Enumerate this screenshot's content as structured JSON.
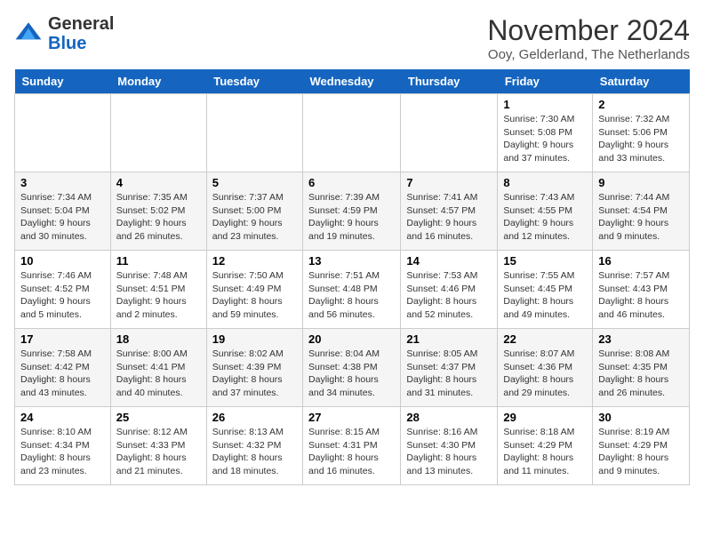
{
  "app": {
    "name": "GeneralBlue",
    "logo_text_general": "General",
    "logo_text_blue": "Blue"
  },
  "header": {
    "month_year": "November 2024",
    "location": "Ooy, Gelderland, The Netherlands"
  },
  "days_of_week": [
    "Sunday",
    "Monday",
    "Tuesday",
    "Wednesday",
    "Thursday",
    "Friday",
    "Saturday"
  ],
  "weeks": [
    [
      {
        "day": "",
        "info": ""
      },
      {
        "day": "",
        "info": ""
      },
      {
        "day": "",
        "info": ""
      },
      {
        "day": "",
        "info": ""
      },
      {
        "day": "",
        "info": ""
      },
      {
        "day": "1",
        "info": "Sunrise: 7:30 AM\nSunset: 5:08 PM\nDaylight: 9 hours and 37 minutes."
      },
      {
        "day": "2",
        "info": "Sunrise: 7:32 AM\nSunset: 5:06 PM\nDaylight: 9 hours and 33 minutes."
      }
    ],
    [
      {
        "day": "3",
        "info": "Sunrise: 7:34 AM\nSunset: 5:04 PM\nDaylight: 9 hours and 30 minutes."
      },
      {
        "day": "4",
        "info": "Sunrise: 7:35 AM\nSunset: 5:02 PM\nDaylight: 9 hours and 26 minutes."
      },
      {
        "day": "5",
        "info": "Sunrise: 7:37 AM\nSunset: 5:00 PM\nDaylight: 9 hours and 23 minutes."
      },
      {
        "day": "6",
        "info": "Sunrise: 7:39 AM\nSunset: 4:59 PM\nDaylight: 9 hours and 19 minutes."
      },
      {
        "day": "7",
        "info": "Sunrise: 7:41 AM\nSunset: 4:57 PM\nDaylight: 9 hours and 16 minutes."
      },
      {
        "day": "8",
        "info": "Sunrise: 7:43 AM\nSunset: 4:55 PM\nDaylight: 9 hours and 12 minutes."
      },
      {
        "day": "9",
        "info": "Sunrise: 7:44 AM\nSunset: 4:54 PM\nDaylight: 9 hours and 9 minutes."
      }
    ],
    [
      {
        "day": "10",
        "info": "Sunrise: 7:46 AM\nSunset: 4:52 PM\nDaylight: 9 hours and 5 minutes."
      },
      {
        "day": "11",
        "info": "Sunrise: 7:48 AM\nSunset: 4:51 PM\nDaylight: 9 hours and 2 minutes."
      },
      {
        "day": "12",
        "info": "Sunrise: 7:50 AM\nSunset: 4:49 PM\nDaylight: 8 hours and 59 minutes."
      },
      {
        "day": "13",
        "info": "Sunrise: 7:51 AM\nSunset: 4:48 PM\nDaylight: 8 hours and 56 minutes."
      },
      {
        "day": "14",
        "info": "Sunrise: 7:53 AM\nSunset: 4:46 PM\nDaylight: 8 hours and 52 minutes."
      },
      {
        "day": "15",
        "info": "Sunrise: 7:55 AM\nSunset: 4:45 PM\nDaylight: 8 hours and 49 minutes."
      },
      {
        "day": "16",
        "info": "Sunrise: 7:57 AM\nSunset: 4:43 PM\nDaylight: 8 hours and 46 minutes."
      }
    ],
    [
      {
        "day": "17",
        "info": "Sunrise: 7:58 AM\nSunset: 4:42 PM\nDaylight: 8 hours and 43 minutes."
      },
      {
        "day": "18",
        "info": "Sunrise: 8:00 AM\nSunset: 4:41 PM\nDaylight: 8 hours and 40 minutes."
      },
      {
        "day": "19",
        "info": "Sunrise: 8:02 AM\nSunset: 4:39 PM\nDaylight: 8 hours and 37 minutes."
      },
      {
        "day": "20",
        "info": "Sunrise: 8:04 AM\nSunset: 4:38 PM\nDaylight: 8 hours and 34 minutes."
      },
      {
        "day": "21",
        "info": "Sunrise: 8:05 AM\nSunset: 4:37 PM\nDaylight: 8 hours and 31 minutes."
      },
      {
        "day": "22",
        "info": "Sunrise: 8:07 AM\nSunset: 4:36 PM\nDaylight: 8 hours and 29 minutes."
      },
      {
        "day": "23",
        "info": "Sunrise: 8:08 AM\nSunset: 4:35 PM\nDaylight: 8 hours and 26 minutes."
      }
    ],
    [
      {
        "day": "24",
        "info": "Sunrise: 8:10 AM\nSunset: 4:34 PM\nDaylight: 8 hours and 23 minutes."
      },
      {
        "day": "25",
        "info": "Sunrise: 8:12 AM\nSunset: 4:33 PM\nDaylight: 8 hours and 21 minutes."
      },
      {
        "day": "26",
        "info": "Sunrise: 8:13 AM\nSunset: 4:32 PM\nDaylight: 8 hours and 18 minutes."
      },
      {
        "day": "27",
        "info": "Sunrise: 8:15 AM\nSunset: 4:31 PM\nDaylight: 8 hours and 16 minutes."
      },
      {
        "day": "28",
        "info": "Sunrise: 8:16 AM\nSunset: 4:30 PM\nDaylight: 8 hours and 13 minutes."
      },
      {
        "day": "29",
        "info": "Sunrise: 8:18 AM\nSunset: 4:29 PM\nDaylight: 8 hours and 11 minutes."
      },
      {
        "day": "30",
        "info": "Sunrise: 8:19 AM\nSunset: 4:29 PM\nDaylight: 8 hours and 9 minutes."
      }
    ]
  ]
}
